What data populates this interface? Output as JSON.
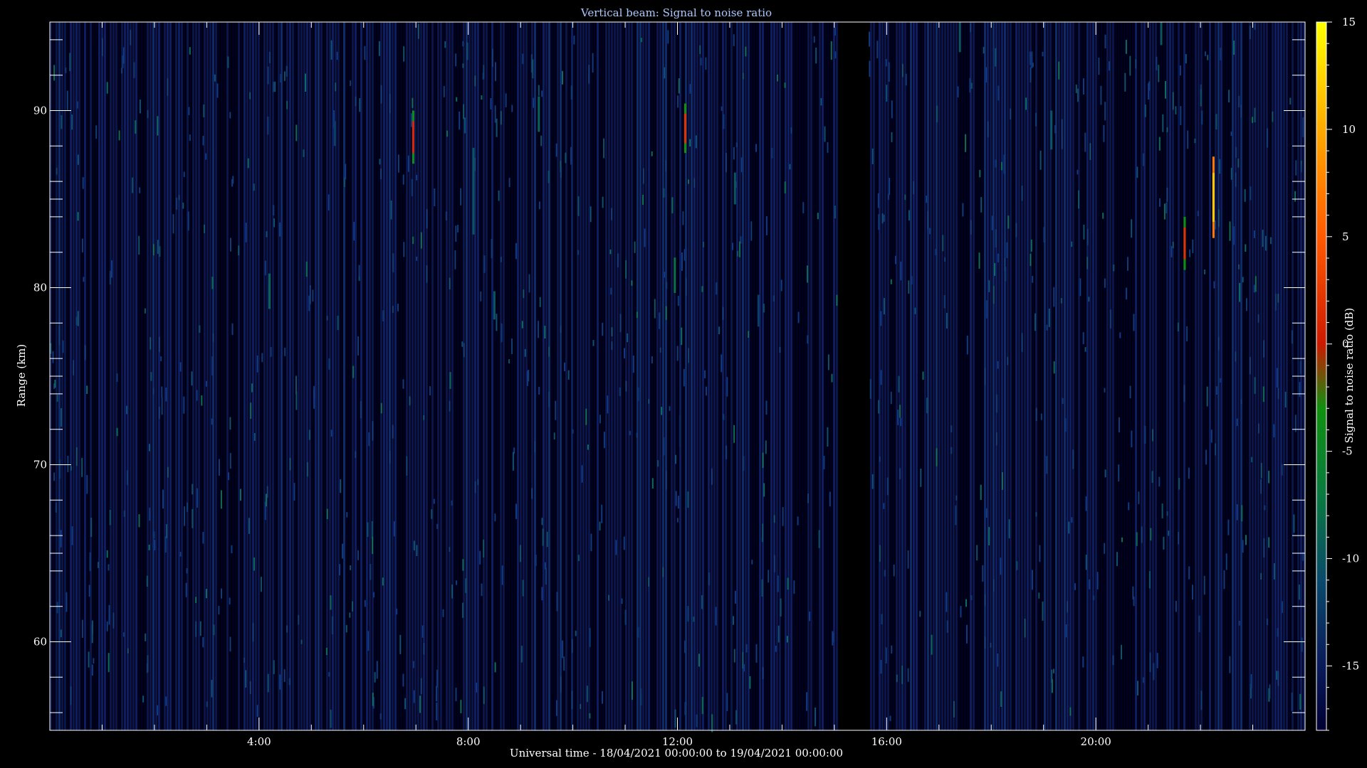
{
  "chart_data": {
    "type": "heatmap",
    "title": "Vertical beam: Signal to noise ratio",
    "xlabel": "Universal time - 18/04/2021 00:00:00 to 19/04/2021 00:00:00",
    "ylabel": "Range (km)",
    "colorbar_label": "Signal to noise ratio (dB)",
    "x_range_hours": [
      0,
      24
    ],
    "y_range_km": [
      55,
      95
    ],
    "x_ticks": [
      {
        "hour": 4,
        "label": "4:00"
      },
      {
        "hour": 8,
        "label": "8:00"
      },
      {
        "hour": 12,
        "label": "12:00"
      },
      {
        "hour": 16,
        "label": "16:00"
      },
      {
        "hour": 20,
        "label": "20:00"
      }
    ],
    "y_ticks": [
      {
        "km": 60,
        "label": "60"
      },
      {
        "km": 70,
        "label": "70"
      },
      {
        "km": 80,
        "label": "80"
      },
      {
        "km": 90,
        "label": "90"
      }
    ],
    "colorbar_range_db": [
      -18,
      15
    ],
    "colorbar_ticks": [
      {
        "db": 15,
        "label": "15"
      },
      {
        "db": 10,
        "label": "10"
      },
      {
        "db": 5,
        "label": "5"
      },
      {
        "db": 0,
        "label": "0"
      },
      {
        "db": -5,
        "label": "-5"
      },
      {
        "db": -10,
        "label": "-10"
      },
      {
        "db": -15,
        "label": "-15"
      }
    ],
    "colormap": [
      {
        "db": -18,
        "color": "#000033"
      },
      {
        "db": -15,
        "color": "#0a1a5a"
      },
      {
        "db": -11,
        "color": "#0a4a6a"
      },
      {
        "db": -7,
        "color": "#0a7a40"
      },
      {
        "db": -3,
        "color": "#109010"
      },
      {
        "db": 0,
        "color": "#cc1a00"
      },
      {
        "db": 5,
        "color": "#ff5a00"
      },
      {
        "db": 10,
        "color": "#ffaa00"
      },
      {
        "db": 15,
        "color": "#ffff00"
      }
    ],
    "background_db": -15,
    "data_gaps_hours": [
      [
        15.05,
        15.65
      ]
    ],
    "events": [
      {
        "t": 4.2,
        "y0": 78.8,
        "y1": 80.8,
        "db": -4
      },
      {
        "t": 5.45,
        "y0": 88.0,
        "y1": 89.4,
        "db": -7
      },
      {
        "t": 6.95,
        "y0": 87.0,
        "y1": 90.0,
        "db": 1
      },
      {
        "t": 8.1,
        "y0": 83.0,
        "y1": 87.9,
        "db": -5
      },
      {
        "t": 8.5,
        "y0": 78.2,
        "y1": 79.8,
        "db": -5
      },
      {
        "t": 9.35,
        "y0": 88.8,
        "y1": 90.8,
        "db": -4
      },
      {
        "t": 11.95,
        "y0": 79.7,
        "y1": 81.7,
        "db": -3
      },
      {
        "t": 12.15,
        "y0": 87.6,
        "y1": 90.4,
        "db": 2
      },
      {
        "t": 12.05,
        "y0": 71.0,
        "y1": 72.8,
        "db": -9
      },
      {
        "t": 13.1,
        "y0": 84.7,
        "y1": 86.5,
        "db": -5
      },
      {
        "t": 13.55,
        "y0": 77.8,
        "y1": 79.6,
        "db": -7
      },
      {
        "t": 17.4,
        "y0": 93.3,
        "y1": 95.0,
        "db": -5
      },
      {
        "t": 19.15,
        "y0": 87.8,
        "y1": 90.0,
        "db": -5
      },
      {
        "t": 21.25,
        "y0": 93.7,
        "y1": 95.0,
        "db": -5
      },
      {
        "t": 21.7,
        "y0": 81.0,
        "y1": 84.0,
        "db": 2
      },
      {
        "t": 22.25,
        "y0": 82.8,
        "y1": 87.4,
        "db": 12
      }
    ]
  }
}
